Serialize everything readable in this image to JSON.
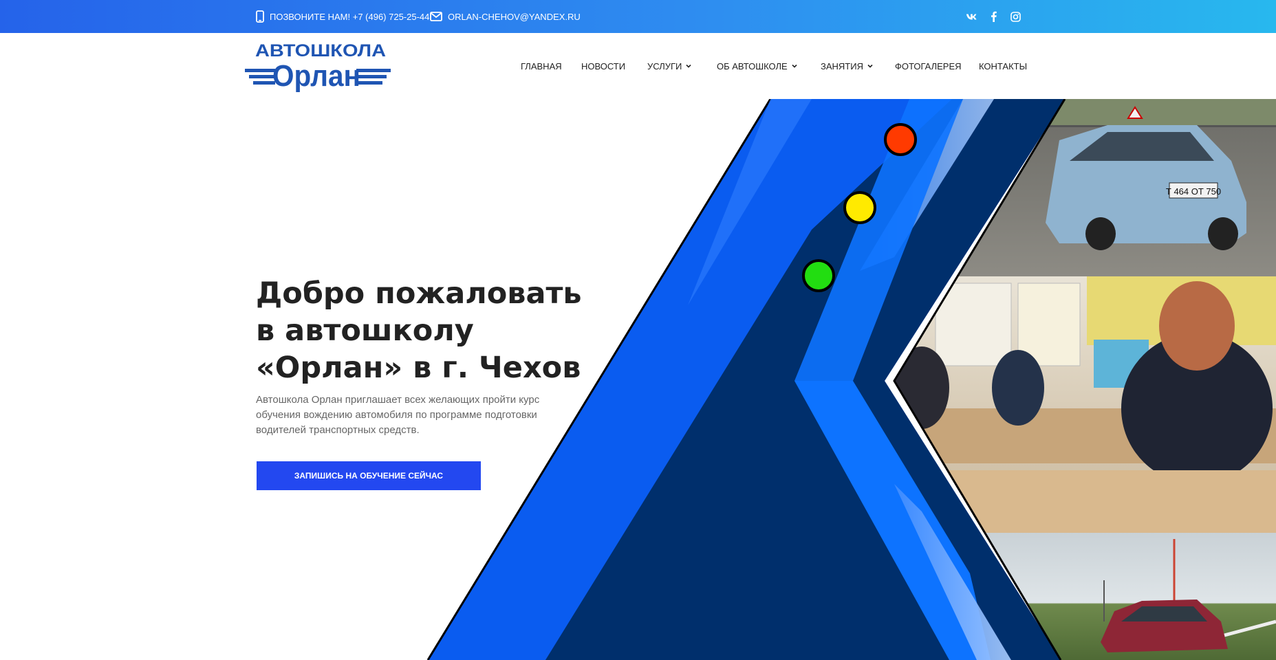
{
  "topbar": {
    "phone_text": "ПОЗВОНИТЕ НАМ! +7 (496) 725-25-44",
    "email_text": "ORLAN-CHEHOV@YANDEX.RU",
    "social": [
      "vk-icon",
      "facebook-icon",
      "instagram-icon"
    ]
  },
  "logo": {
    "line1": "АВТОШКОЛА",
    "line2": "Орлан"
  },
  "nav": {
    "items": [
      {
        "label": "ГЛАВНАЯ",
        "dropdown": false
      },
      {
        "label": "НОВОСТИ",
        "dropdown": false
      },
      {
        "label": "УСЛУГИ",
        "dropdown": true
      },
      {
        "label": "ОБ АВТОШКОЛЕ",
        "dropdown": true
      },
      {
        "label": "ЗАНЯТИЯ",
        "dropdown": true
      },
      {
        "label": "ФОТОГАЛЕРЕЯ",
        "dropdown": false
      },
      {
        "label": "КОНТАКТЫ",
        "dropdown": false
      }
    ]
  },
  "hero": {
    "title_lines": [
      "Добро пожаловать",
      "в автошколу",
      "«Орлан» в г. Чехов"
    ],
    "text": "Автошкола Орлан приглашает всех желающих пройти курс обучения вождению автомобиля по программе подготовки водителей транспортных средств.",
    "button_label": "ЗАПИШИСЬ НА ОБУЧЕНИЕ СЕЙЧАС",
    "traffic_light": [
      "#ff3a00",
      "#ffea00",
      "#22dd11"
    ],
    "photo_plate": "Т 464 ОТ 750"
  },
  "colors": {
    "topbar_start": "#2563ea",
    "topbar_end": "#28b8ee",
    "brand_blue": "#1f55b3",
    "button": "#2348f0",
    "hero_navy": "#002f6c",
    "hero_blue": "#0a5cf0"
  }
}
